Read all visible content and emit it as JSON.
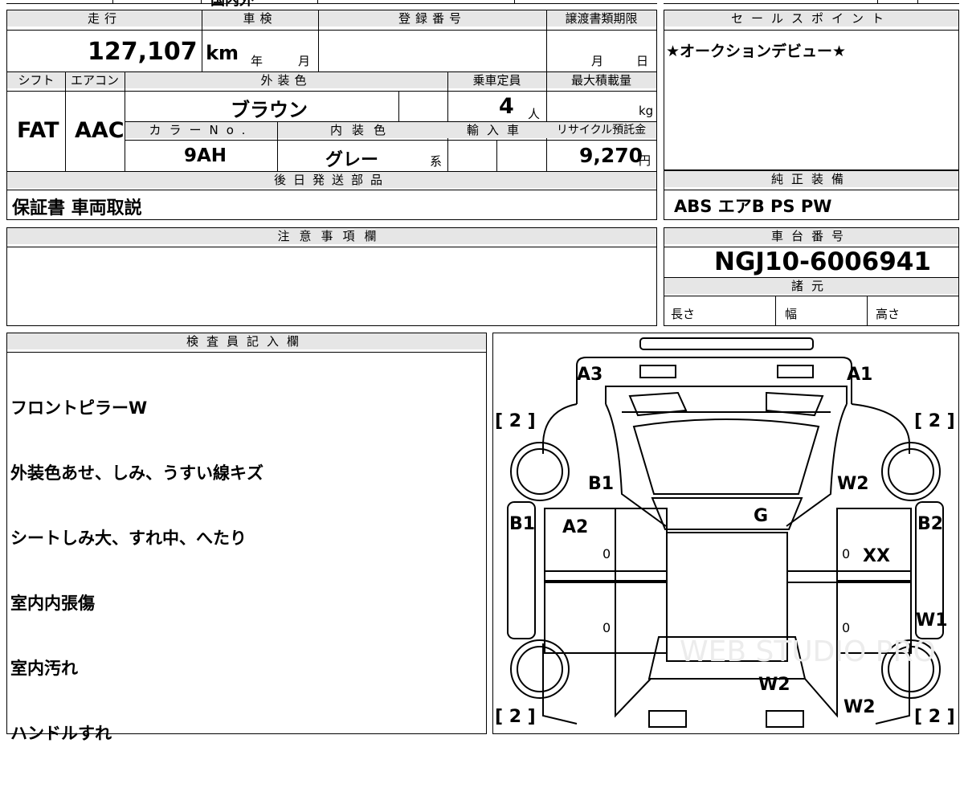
{
  "top_fragment": "国内外",
  "basic": {
    "mileage_label": "走行",
    "shaken_label": "車検",
    "registration_label": "登録番号",
    "transfer_deadline_label": "譲渡書類期限",
    "mileage_value": "127,107",
    "mileage_unit": "km",
    "shaken_year_label": "年",
    "shaken_month_label": "月",
    "deadline_month_label": "月",
    "deadline_day_label": "日",
    "shift_label": "シフト",
    "ac_label": "エアコン",
    "exterior_color_label": "外装色",
    "capacity_label": "乗車定員",
    "max_load_label": "最大積載量",
    "shift_value": "FAT",
    "ac_value": "AAC",
    "exterior_color_value": "ブラウン",
    "capacity_value": "4",
    "capacity_unit": "人",
    "max_load_unit": "kg",
    "color_no_label": "カラーNo.",
    "interior_color_label": "内装色",
    "import_label": "輸入車",
    "recycle_label": "リサイクル預託金",
    "color_no_value": "9AH",
    "interior_color_value": "グレー",
    "interior_color_suffix": "系",
    "recycle_value": "9,270",
    "recycle_unit": "円",
    "later_parts_label": "後日発送部品",
    "later_parts_value": "保証書 車両取説"
  },
  "sales_point": {
    "label": "セールスポイント",
    "value": "★オークションデビュー★"
  },
  "equipment": {
    "label": "純正装備",
    "value": "ABS エアB PS PW"
  },
  "caution": {
    "label": "注意事項欄"
  },
  "chassis": {
    "label": "車台番号",
    "value": "NGJ10-6006941"
  },
  "specs": {
    "label": "諸元",
    "length_label": "長さ",
    "width_label": "幅",
    "height_label": "高さ"
  },
  "inspector": {
    "label": "検査員記入欄",
    "notes": [
      "フロントピラーW",
      "外装色あせ、しみ、うすい線キズ",
      "シートしみ大、すれ中、へたり",
      "室内内張傷",
      "室内汚れ",
      "ハンドルすれ"
    ]
  },
  "diagram": {
    "bracket_value": "[ 2 ]",
    "marks": {
      "a3": "A3",
      "a1": "A1",
      "b1_front": "B1",
      "w2_front": "W2",
      "b1_side": "B1",
      "a2": "A2",
      "g": "G",
      "b2": "B2",
      "xx": "XX",
      "w1": "W1",
      "w2_rear": "W2",
      "w2_rear_right": "W2"
    },
    "door_zero": "0",
    "watermark": "WEB STUDIO PRO"
  }
}
